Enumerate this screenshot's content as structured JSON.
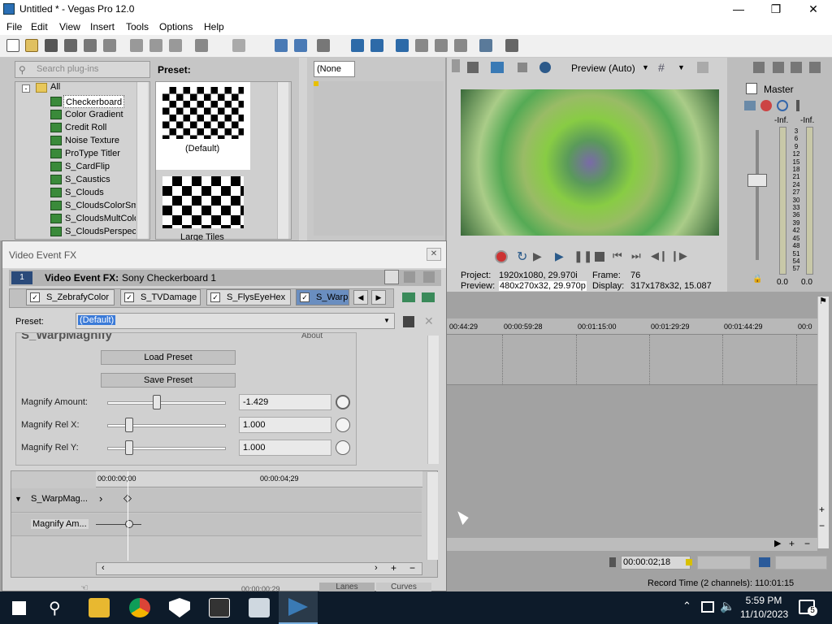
{
  "window": {
    "title": "Untitled * - Vegas Pro 12.0"
  },
  "menu": [
    "File",
    "Edit",
    "View",
    "Insert",
    "Tools",
    "Options",
    "Help"
  ],
  "plugins": {
    "search_placeholder": "Search plug-ins",
    "root": "All",
    "items": [
      "Checkerboard",
      "Color Gradient",
      "Credit Roll",
      "Noise Texture",
      "ProType Titler",
      "S_CardFlip",
      "S_Caustics",
      "S_Clouds",
      "S_CloudsColorSmo",
      "S_CloudsMultColo",
      "S_CloudsPerspect"
    ],
    "selected": "Checkerboard"
  },
  "presets": {
    "header": "Preset:",
    "items": [
      "(Default)",
      "Large Tiles"
    ]
  },
  "track_select": {
    "value": "(None"
  },
  "preview": {
    "quality": "Preview (Auto)",
    "project_label": "Project:",
    "project_value": "1920x1080, 29.970i",
    "preview_label": "Preview:",
    "preview_value": "480x270x32, 29.970p",
    "frame_label": "Frame:",
    "frame_value": "76",
    "display_label": "Display:",
    "display_value": "317x178x32, 15.087"
  },
  "master": {
    "label": "Master",
    "inf_left": "-Inf.",
    "inf_right": "-Inf.",
    "scale": [
      "3",
      "6",
      "9",
      "12",
      "15",
      "18",
      "21",
      "24",
      "27",
      "30",
      "33",
      "36",
      "39",
      "42",
      "45",
      "48",
      "51",
      "54",
      "57"
    ],
    "value_left": "0.0",
    "value_right": "0.0"
  },
  "timeline": {
    "ruler": [
      "00:44:29",
      "00:00:59:28",
      "00:01:15:00",
      "00:01:29:29",
      "00:01:44:29",
      "00:0"
    ],
    "cursor_time": "00:00:02;18",
    "record_time": "Record Time (2 channels): 110:01:15"
  },
  "fx": {
    "window_title": "Video Event FX",
    "header_label": "Video Event FX:",
    "header_value": "Sony Checkerboard 1",
    "tabs": [
      "S_ZebrafyColor",
      "S_TVDamage",
      "S_FlysEyeHex",
      "S_Warp"
    ],
    "preset_label": "Preset:",
    "preset_value": "(Default)",
    "plugin_header": "S_WarpMagnify",
    "about": "About",
    "load_preset": "Load Preset",
    "save_preset": "Save Preset",
    "params": [
      {
        "label": "Magnify Amount:",
        "value": "-1.429"
      },
      {
        "label": "Magnify Rel X:",
        "value": "1.000"
      },
      {
        "label": "Magnify Rel Y:",
        "value": "1.000"
      }
    ],
    "kf_ruler": [
      "00:00:00;00",
      "00:00:04;29"
    ],
    "kf_tracks": [
      "S_WarpMag...",
      "Magnify Am..."
    ],
    "bottom_time": "00:00:00;29",
    "bottom_tabs": [
      "Lanes",
      "Curves"
    ]
  },
  "clock": {
    "time": "5:59 PM",
    "date": "11/10/2023"
  },
  "notifications": "5"
}
